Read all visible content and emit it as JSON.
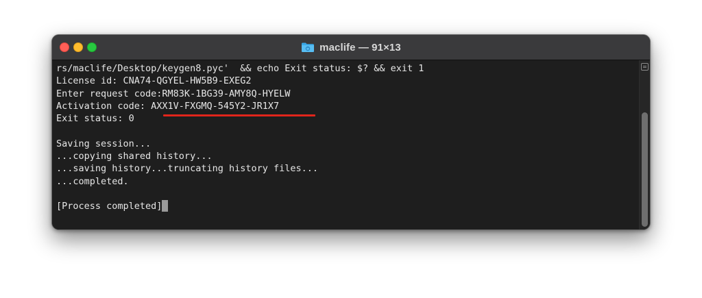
{
  "window": {
    "title": "maclife — 91×13",
    "folder_icon": "folder-icon"
  },
  "terminal": {
    "lines": [
      "rs/maclife/Desktop/keygen8.pyc'  && echo Exit status: $? && exit 1",
      "License id: CNA74-QGYEL-HW5B9-EXEG2",
      "Enter request code:RM83K-1BG39-AMY8Q-HYELW",
      "Exit status: 0",
      "",
      "Saving session...",
      "...copying shared history...",
      "...saving history...truncating history files...",
      "...completed.",
      "",
      "[Process completed]"
    ],
    "activation_label": "Activation code: ",
    "activation_code": "AXX1V-FXGMQ-545Y2-JR1X7"
  },
  "colors": {
    "close": "#ff5f57",
    "minimize": "#febc2e",
    "zoom": "#28c840",
    "highlight_underline": "#e1251b",
    "terminal_bg": "#1e1e1e",
    "terminal_text": "#e6e6e6"
  },
  "icons": {
    "scroll_menu": "scroll-menu-icon",
    "cursor": "block-cursor"
  }
}
